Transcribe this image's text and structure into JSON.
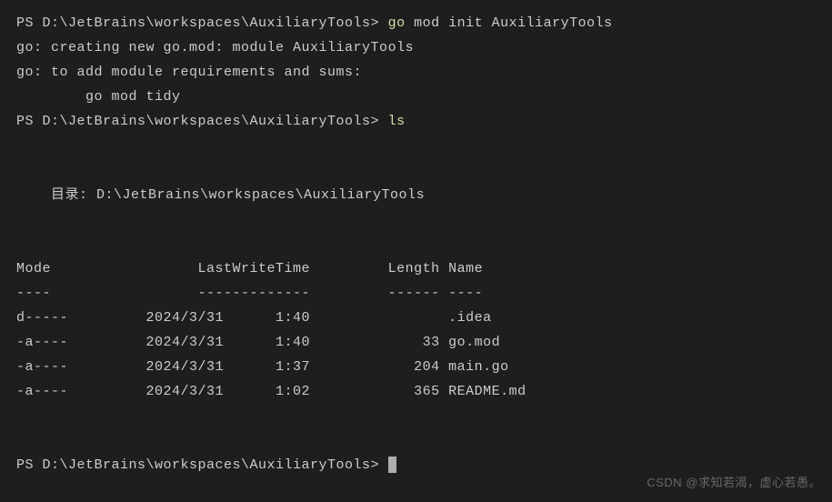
{
  "lines": {
    "l1_prompt": "PS D:\\JetBrains\\workspaces\\AuxiliaryTools> ",
    "l1_cmd1": "go",
    "l1_cmd2": " mod init AuxiliaryTools",
    "l2": "go: creating new go.mod: module AuxiliaryTools",
    "l3": "go: to add module requirements and sums:",
    "l4": "        go mod tidy",
    "l5_prompt": "PS D:\\JetBrains\\workspaces\\AuxiliaryTools> ",
    "l5_cmd": "ls",
    "l6": "    目录: D:\\JetBrains\\workspaces\\AuxiliaryTools",
    "header": "Mode                 LastWriteTime         Length Name",
    "divider": "----                 -------------         ------ ----",
    "row1": "d-----         2024/3/31      1:40                .idea",
    "row2": "-a----         2024/3/31      1:40             33 go.mod",
    "row3": "-a----         2024/3/31      1:37            204 main.go",
    "row4": "-a----         2024/3/31      1:02            365 README.md",
    "final_prompt": "PS D:\\JetBrains\\workspaces\\AuxiliaryTools> "
  },
  "watermark": "CSDN @求知若渴，虚心若愚。"
}
